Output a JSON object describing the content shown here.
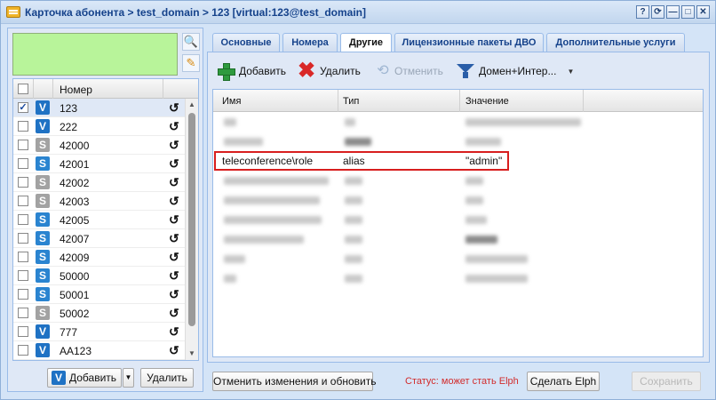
{
  "window": {
    "title": "Карточка абонента > test_domain > 123 [virtual:123@test_domain]",
    "buttons": [
      "?",
      "⟳",
      "—",
      "□",
      "✕"
    ]
  },
  "left": {
    "column_header": "Номер",
    "rows": [
      {
        "number": "123",
        "type": "V",
        "checked": true
      },
      {
        "number": "222",
        "type": "V",
        "checked": false
      },
      {
        "number": "42000",
        "type": "S-gray",
        "checked": false
      },
      {
        "number": "42001",
        "type": "S",
        "checked": false
      },
      {
        "number": "42002",
        "type": "S-gray",
        "checked": false
      },
      {
        "number": "42003",
        "type": "S-gray",
        "checked": false
      },
      {
        "number": "42005",
        "type": "S",
        "checked": false
      },
      {
        "number": "42007",
        "type": "S",
        "checked": false
      },
      {
        "number": "42009",
        "type": "S",
        "checked": false
      },
      {
        "number": "50000",
        "type": "S",
        "checked": false
      },
      {
        "number": "50001",
        "type": "S",
        "checked": false
      },
      {
        "number": "50002",
        "type": "S-gray",
        "checked": false
      },
      {
        "number": "777",
        "type": "V",
        "checked": false
      },
      {
        "number": "AA123",
        "type": "V",
        "checked": false
      }
    ],
    "add_label": "Добавить",
    "delete_label": "Удалить"
  },
  "tabs": [
    "Основные",
    "Номера",
    "Другие",
    "Лицензионные пакеты ДВО",
    "Дополнительные услуги"
  ],
  "active_tab": "Другие",
  "toolbar": {
    "add_label": "Добавить",
    "delete_label": "Удалить",
    "undo_label": "Отменить",
    "filter_label": "Домен+Интер..."
  },
  "grid": {
    "columns": [
      "Имя",
      "Тип",
      "Значение"
    ],
    "highlight_row": {
      "name": "teleconference\\role",
      "type": "alias",
      "value": "\"admin\""
    }
  },
  "bottom": {
    "revert_label": "Отменить изменения и обновить",
    "status_text": "Статус: может стать Elph",
    "make_elph_label": "Сделать Elph",
    "save_label": "Сохранить"
  }
}
